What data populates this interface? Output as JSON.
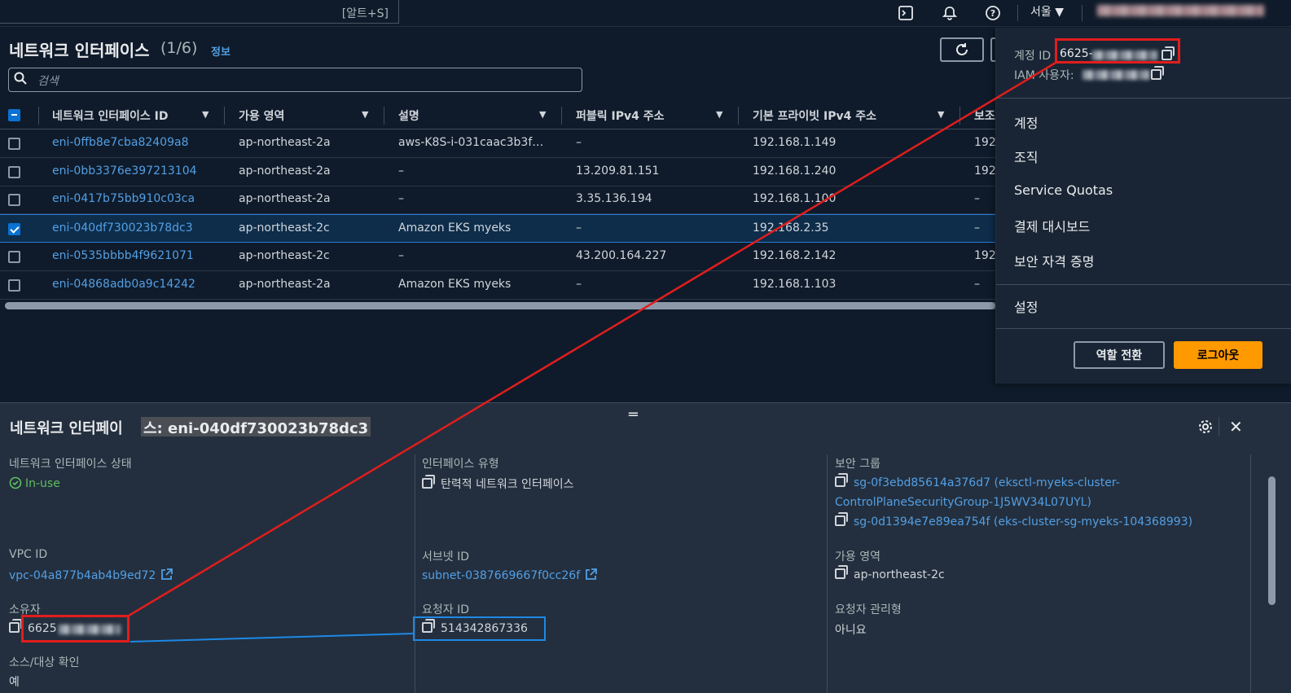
{
  "topbar": {
    "search_shortcut": "[알트+S]",
    "region": "서울 ▼",
    "icons": [
      "cloudshell-icon",
      "bell-icon",
      "help-icon"
    ]
  },
  "list": {
    "title": "네트워크 인터페이스",
    "count": "(1/6)",
    "info": "정보",
    "search_placeholder": "검색",
    "columns": [
      "네트워크 인터페이스 ID",
      "가용 영역",
      "설명",
      "퍼블릭 IPv4 주소",
      "기본 프라이빗 IPv4 주소",
      "보조"
    ],
    "rows": [
      {
        "id": "eni-0ffb8e7cba82409a8",
        "az": "ap-northeast-2a",
        "desc": "aws-K8S-i-031caac3b3f…",
        "public_ip": "–",
        "private_ip": "192.168.1.149",
        "extra": "192",
        "selected": false
      },
      {
        "id": "eni-0bb3376e397213104",
        "az": "ap-northeast-2a",
        "desc": "–",
        "public_ip": "13.209.81.151",
        "private_ip": "192.168.1.240",
        "extra": "192",
        "selected": false
      },
      {
        "id": "eni-0417b75bb910c03ca",
        "az": "ap-northeast-2a",
        "desc": "–",
        "public_ip": "3.35.136.194",
        "private_ip": "192.168.1.100",
        "extra": "–",
        "selected": false
      },
      {
        "id": "eni-040df730023b78dc3",
        "az": "ap-northeast-2c",
        "desc": "Amazon EKS myeks",
        "public_ip": "–",
        "private_ip": "192.168.2.35",
        "extra": "–",
        "selected": true
      },
      {
        "id": "eni-0535bbbb4f9621071",
        "az": "ap-northeast-2c",
        "desc": "–",
        "public_ip": "43.200.164.227",
        "private_ip": "192.168.2.142",
        "extra": "192",
        "selected": false
      },
      {
        "id": "eni-04868adb0a9c14242",
        "az": "ap-northeast-2a",
        "desc": "Amazon EKS myeks",
        "public_ip": "–",
        "private_ip": "192.168.1.103",
        "extra": "–",
        "selected": false
      }
    ]
  },
  "account_menu": {
    "account_id_label": "계정 ID",
    "account_id_value": "6625-",
    "iam_user_label": "IAM 사용자:",
    "items": [
      "계정",
      "조직",
      "Service Quotas",
      "결제 대시보드",
      "보안 자격 증명"
    ],
    "settings": "설정",
    "switch_role": "역할 전환",
    "logout": "로그아웃"
  },
  "detail": {
    "title_prefix": "네트워크 인터페이",
    "title_highlight": "스: eni-040df730023b78dc3",
    "fields": {
      "status_label": "네트워크 인터페이스 상태",
      "status_value": "In-use",
      "type_label": "인터페이스 유형",
      "type_value": "탄력적 네트워크 인터페이스",
      "sg_label": "보안 그룹",
      "sg_value_1a": "sg-0f3ebd85614a376d7 (eksctl-myeks-cluster-",
      "sg_value_1b": "ControlPlaneSecurityGroup-1J5WV34L07UYL)",
      "sg_value_2": "sg-0d1394e7e89ea754f (eks-cluster-sg-myeks-104368993)",
      "vpc_label": "VPC ID",
      "vpc_value": "vpc-04a877b4ab4b9ed72",
      "subnet_label": "서브넷 ID",
      "subnet_value": "subnet-0387669667f0cc26f",
      "az_label": "가용 영역",
      "az_value": "ap-northeast-2c",
      "owner_label": "소유자",
      "owner_value": "6625",
      "requester_label": "요청자 ID",
      "requester_value": "514342867336",
      "req_managed_label": "요청자 관리형",
      "req_managed_value": "아니요",
      "srcdst_label": "소스/대상 확인",
      "srcdst_value": "예"
    }
  },
  "colors": {
    "accent": "#539fe5",
    "logout": "#ff9900",
    "annotation_red": "#e11d1d",
    "annotation_blue": "#1e88e5"
  }
}
